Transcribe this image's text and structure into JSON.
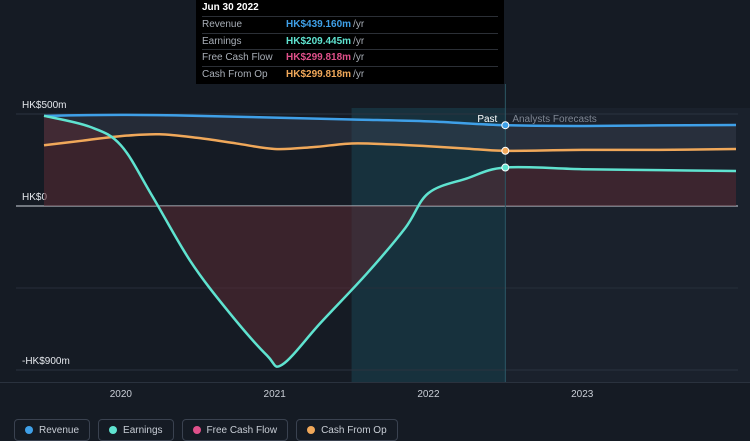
{
  "tooltip": {
    "date": "Jun 30 2022",
    "rows": [
      {
        "label": "Revenue",
        "value": "HK$439.160m",
        "unit": "/yr",
        "color": "#3fa0e8"
      },
      {
        "label": "Earnings",
        "value": "HK$209.445m",
        "unit": "/yr",
        "color": "#5fe3d0"
      },
      {
        "label": "Free Cash Flow",
        "value": "HK$299.818m",
        "unit": "/yr",
        "color": "#e0508a"
      },
      {
        "label": "Cash From Op",
        "value": "HK$299.818m",
        "unit": "/yr",
        "color": "#f0a85a"
      }
    ]
  },
  "markers": {
    "past": "Past",
    "forecast": "Analysts Forecasts"
  },
  "legend": [
    {
      "label": "Revenue",
      "color": "#3fa0e8"
    },
    {
      "label": "Earnings",
      "color": "#5fe3d0"
    },
    {
      "label": "Free Cash Flow",
      "color": "#e0508a"
    },
    {
      "label": "Cash From Op",
      "color": "#f0a85a"
    }
  ],
  "chart_data": {
    "type": "line",
    "y_tick_labels": [
      "HK$500m",
      "HK$0",
      "-HK$900m"
    ],
    "y_ticks": [
      500,
      0,
      -900
    ],
    "ylim": [
      -900,
      500
    ],
    "x_tick_labels": [
      "2020",
      "2021",
      "2022",
      "2023"
    ],
    "x_ticks": [
      2020,
      2021,
      2022,
      2023
    ],
    "xlim": [
      2019.5,
      2024.0
    ],
    "divider_x": 2022.5,
    "shaded_from": 2021.5,
    "series": [
      {
        "name": "Revenue",
        "color": "#3fa0e8",
        "x": [
          2019.5,
          2020.0,
          2020.5,
          2021.0,
          2021.5,
          2022.0,
          2022.5,
          2023.0,
          2023.5,
          2024.0
        ],
        "y": [
          490,
          495,
          490,
          480,
          470,
          460,
          439,
          435,
          438,
          440
        ]
      },
      {
        "name": "Earnings",
        "color": "#5fe3d0",
        "x": [
          2019.5,
          2019.8,
          2020.0,
          2020.2,
          2020.45,
          2020.7,
          2020.95,
          2021.05,
          2021.3,
          2021.6,
          2021.85,
          2022.0,
          2022.25,
          2022.5,
          2023.0,
          2023.5,
          2024.0
        ],
        "y": [
          490,
          430,
          330,
          60,
          -300,
          -580,
          -820,
          -870,
          -640,
          -370,
          -120,
          70,
          150,
          209,
          200,
          195,
          190
        ]
      },
      {
        "name": "Cash From Op",
        "color": "#f0a85a",
        "x": [
          2019.5,
          2019.75,
          2020.0,
          2020.25,
          2020.5,
          2020.75,
          2021.0,
          2021.25,
          2021.5,
          2021.75,
          2022.0,
          2022.25,
          2022.5,
          2023.0,
          2023.5,
          2024.0
        ],
        "y": [
          330,
          355,
          380,
          390,
          370,
          340,
          310,
          320,
          340,
          335,
          325,
          312,
          300,
          305,
          305,
          310
        ]
      }
    ]
  }
}
